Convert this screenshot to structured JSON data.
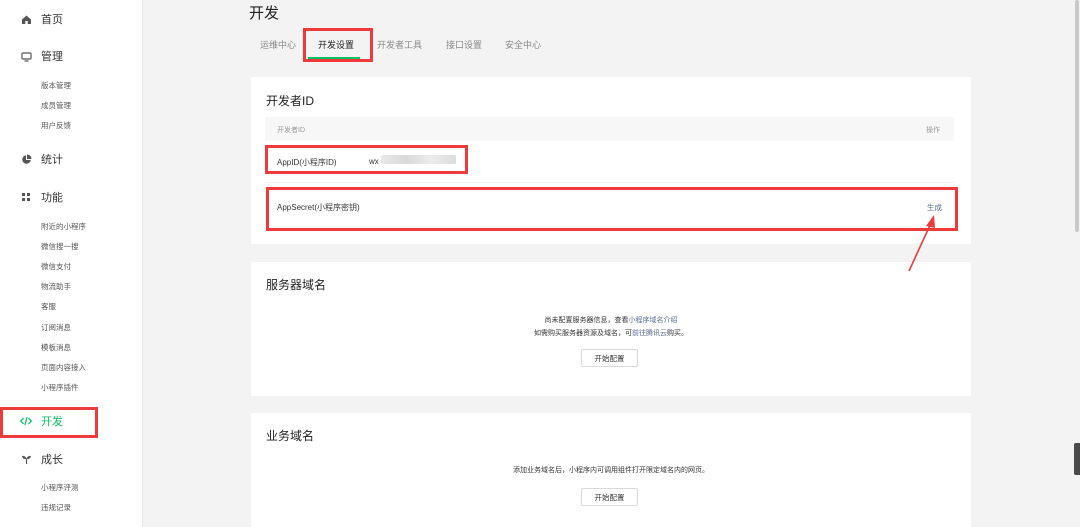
{
  "sidebar": {
    "home_label": "首页",
    "manage_label": "管理",
    "manage_items": [
      "版本管理",
      "成员管理",
      "用户反馈"
    ],
    "stats_label": "统计",
    "features_label": "功能",
    "features_items": [
      "附近的小程序",
      "微信搜一搜",
      "微信支付",
      "物流助手",
      "客服",
      "订阅消息",
      "模板消息",
      "页面内容接入",
      "小程序插件"
    ],
    "dev_label": "开发",
    "growth_label": "成长",
    "growth_items": [
      "小程序评测",
      "违规记录"
    ]
  },
  "page": {
    "title": "开发"
  },
  "tabs": [
    "运维中心",
    "开发设置",
    "开发者工具",
    "接口设置",
    "安全中心"
  ],
  "developer_id": {
    "title": "开发者ID",
    "col_id": "开发者ID",
    "col_action": "操作",
    "appid_label": "AppID(小程序ID)",
    "appid_value": "wx",
    "appsecret_label": "AppSecret(小程序密钥)",
    "generate_link": "生成"
  },
  "server_domain": {
    "title": "服务器域名",
    "line1_prefix": "尚未配置服务器信息，查看",
    "line1_link": "小程序域名介绍",
    "line2_prefix": "如需购买服务器资源及域名，可",
    "line2_link": "前往腾讯云",
    "line2_suffix": "购买。",
    "button": "开始配置"
  },
  "business_domain": {
    "title": "业务域名",
    "line1": "添加业务域名后，小程序内可调用组件打开限定域名内的网页。",
    "button": "开始配置"
  },
  "colors": {
    "accent": "#07c160",
    "annotation": "#ee3a3a",
    "link": "#576b95"
  }
}
